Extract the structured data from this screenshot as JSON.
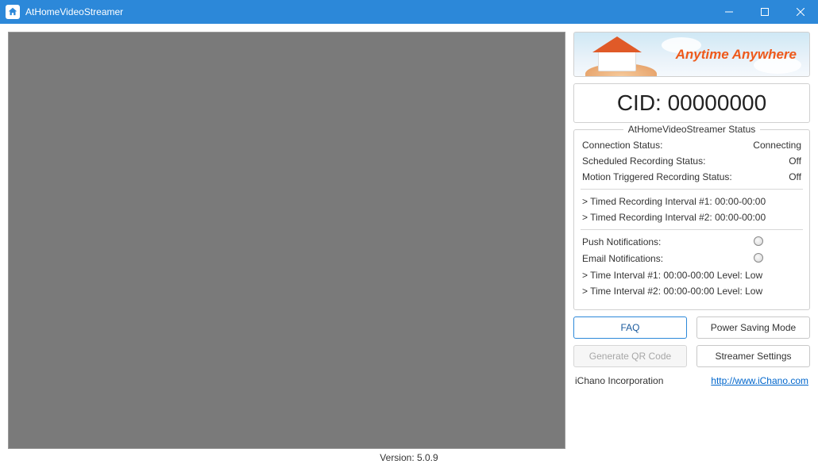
{
  "window": {
    "title": "AtHomeVideoStreamer"
  },
  "banner": {
    "text": "Anytime Anywhere"
  },
  "cid": {
    "text": "CID: 00000000"
  },
  "status": {
    "legend": "AtHomeVideoStreamer Status",
    "connection_label": "Connection Status:",
    "connection_value": "Connecting",
    "scheduled_label": "Scheduled Recording Status:",
    "scheduled_value": "Off",
    "motion_label": "Motion Triggered Recording Status:",
    "motion_value": "Off",
    "timed1": "> Timed Recording Interval #1:  00:00-00:00",
    "timed2": "> Timed Recording Interval #2:  00:00-00:00",
    "push_label": "Push Notifications:",
    "email_label": "Email Notifications:",
    "time1": "> Time Interval #1:  00:00-00:00   Level: Low",
    "time2": "> Time Interval #2:  00:00-00:00   Level: Low"
  },
  "buttons": {
    "faq": "FAQ",
    "power_saving": "Power Saving Mode",
    "generate_qr": "Generate QR Code",
    "streamer_settings": "Streamer Settings"
  },
  "footer": {
    "company": "iChano Incorporation",
    "url_text": "http://www.iChano.com"
  },
  "version": {
    "text": "Version: 5.0.9"
  }
}
